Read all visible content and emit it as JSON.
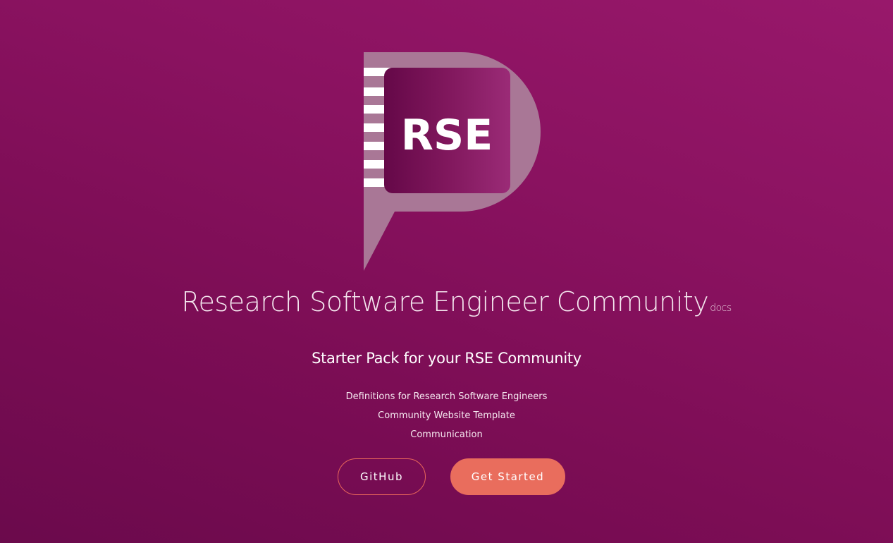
{
  "logo": {
    "text": "RSE"
  },
  "header": {
    "title": "Research Software Engineer Community",
    "title_suffix": "docs"
  },
  "main": {
    "tagline": "Starter Pack for your RSE Community",
    "features": [
      "Definitions for Research Software Engineers",
      "Community Website Template",
      "Communication"
    ]
  },
  "actions": {
    "github_label": "GitHub",
    "get_started_label": "Get Started"
  },
  "colors": {
    "background_start": "#6b0a4c",
    "background_end": "#98186b",
    "accent": "#e96d5d",
    "logo_bubble": "#a97796",
    "logo_square_start": "#6a0a4a",
    "logo_square_end": "#9a2a75"
  }
}
